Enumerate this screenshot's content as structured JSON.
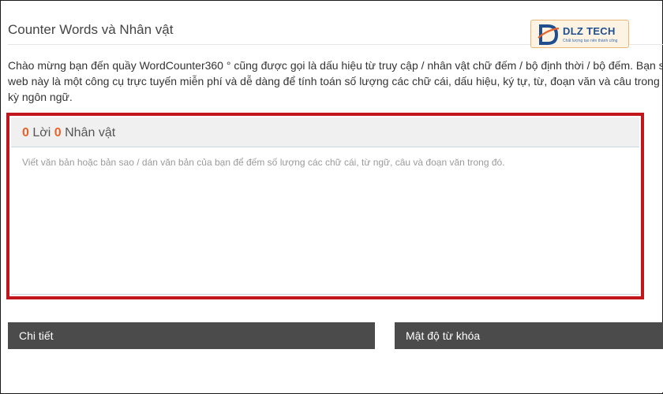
{
  "page": {
    "title": "Counter Words và Nhân vật",
    "intro_lines": [
      "Chào mừng bạn đến quầy WordCounter360 ° cũng được gọi là dấu hiệu từ truy cập / nhân vật chữ đếm / bộ định thời / bộ đếm. Bạn sẽ",
      "web này là một công cụ trực tuyến miễn phí và dễ dàng để tính toán số lượng các chữ cái, dấu hiệu, ký tự, từ, đoạn văn và câu trong m",
      "kỳ ngôn ngữ."
    ]
  },
  "logo": {
    "brand": "DLZ TECH",
    "slogan": "Chất lượng tạo nên thành công"
  },
  "counter": {
    "word_count": "0",
    "word_label": "Lời",
    "char_count": "0",
    "char_label": "Nhân vật",
    "placeholder": "Viết văn bản hoặc bản sao / dán văn bản của bạn để đếm số lượng các chữ cái, từ ngữ, câu và đoạn văn trong đó.",
    "value": ""
  },
  "panels": {
    "details": "Chi tiết",
    "keyword_density": "Mật độ từ khóa"
  },
  "colors": {
    "highlight_border": "#c0161c",
    "count_accent": "#e8632b",
    "panel_header": "#4b4b4b"
  }
}
